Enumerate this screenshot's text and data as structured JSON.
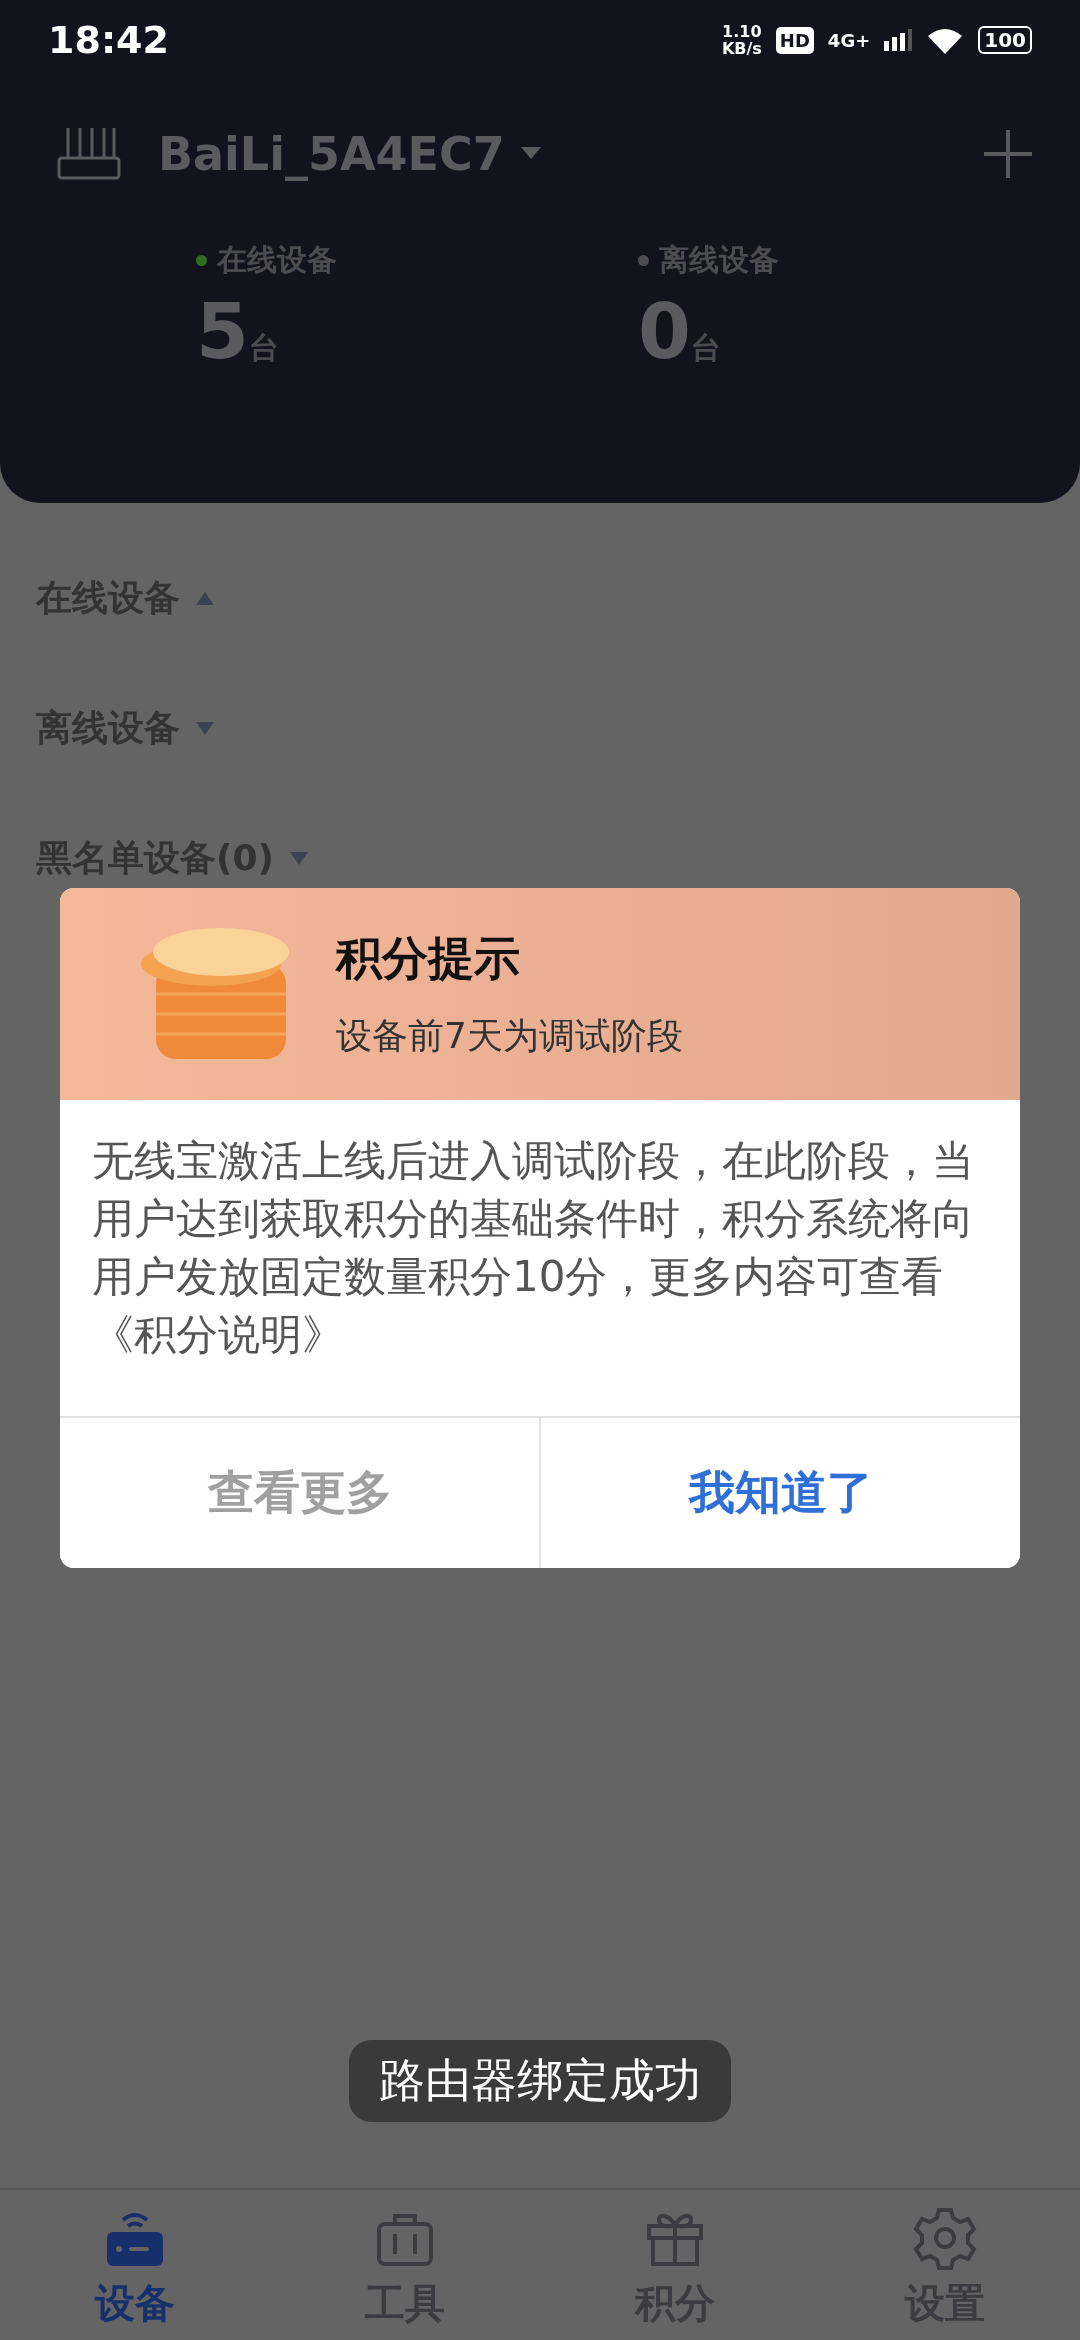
{
  "status_bar": {
    "time": "18:42",
    "speed": "1.10",
    "speed_unit": "KB/s",
    "hd": "HD",
    "network": "4G+",
    "battery": "100"
  },
  "router": {
    "name": "BaiLi_5A4EC7"
  },
  "stats": [
    {
      "label": "在线设备",
      "value": "5",
      "unit": "台",
      "color": "#2f6e22"
    },
    {
      "label": "离线设备",
      "value": "0",
      "unit": "台",
      "color": "#4c4c50"
    }
  ],
  "sections": [
    {
      "label": "在线设备",
      "expanded": true
    },
    {
      "label": "离线设备",
      "expanded": false
    },
    {
      "label": "黑名单设备(0)",
      "expanded": false
    }
  ],
  "dialog": {
    "title": "积分提示",
    "subtitle": "设备前7天为调试阶段",
    "body": "无线宝激活上线后进入调试阶段，在此阶段，当用户达到获取积分的基础条件时，积分系统将向用户发放固定数量积分10分，更多内容可查看",
    "link": "《积分说明》",
    "buttons": [
      {
        "label": "查看更多",
        "primary": false
      },
      {
        "label": "我知道了",
        "primary": true
      }
    ]
  },
  "toast": "路由器绑定成功",
  "tabs": [
    {
      "label": "设备",
      "kind": "router",
      "selected": true
    },
    {
      "label": "工具",
      "kind": "toolbox",
      "selected": false
    },
    {
      "label": "积分",
      "kind": "gift",
      "selected": false
    },
    {
      "label": "设置",
      "kind": "gear",
      "selected": false
    }
  ]
}
